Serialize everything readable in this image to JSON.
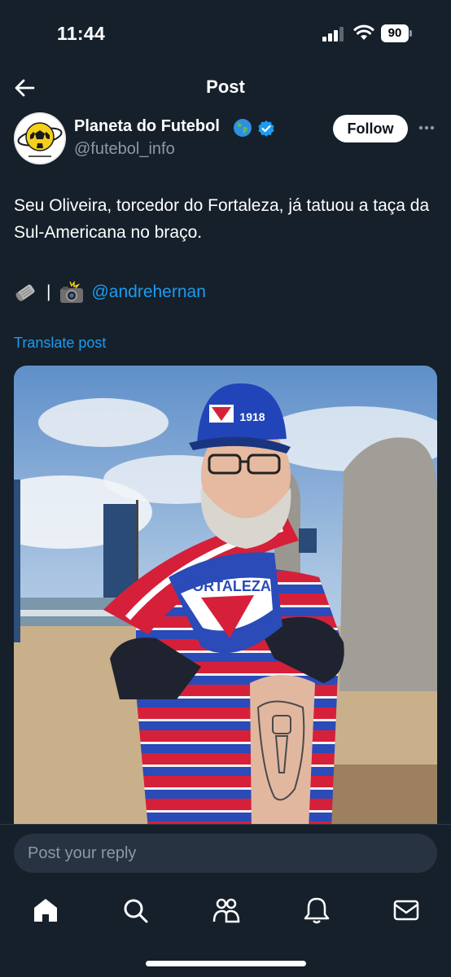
{
  "status_bar": {
    "time": "11:44",
    "battery": "90"
  },
  "header": {
    "title": "Post"
  },
  "author": {
    "name": "Planeta do Futebol",
    "handle": "@futebol_info",
    "follow_label": "Follow"
  },
  "post": {
    "text": "Seu Oliveira, torcedor do Fortaleza, já tatuou a taça da Sul-Americana no braço.",
    "credit_separator": "|",
    "mention": "@andrehernan",
    "translate_label": "Translate post",
    "image_scarf_text": "FORTALEZA",
    "image_cap_text": "1918"
  },
  "reply": {
    "placeholder": "Post your reply"
  },
  "tabs": [
    "home-icon",
    "search-icon",
    "communities-icon",
    "notifications-icon",
    "messages-icon"
  ],
  "colors": {
    "background": "#15202b",
    "accent": "#1d9bf0",
    "muted": "#8b98a5"
  }
}
